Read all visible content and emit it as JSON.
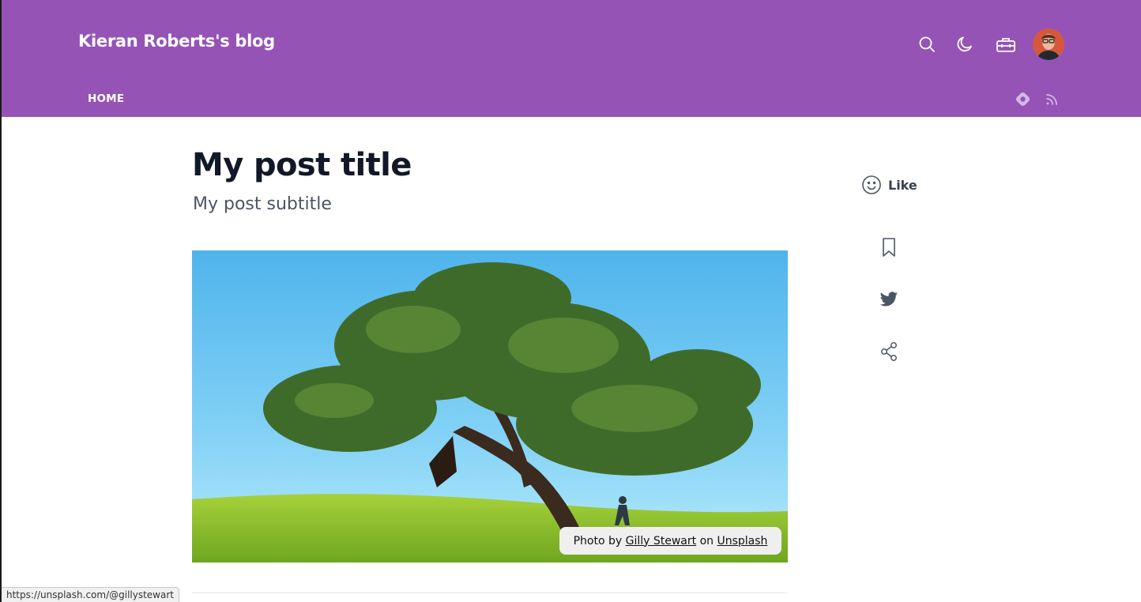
{
  "header": {
    "blog_title": "Kieran Roberts's blog",
    "nav": {
      "home": "HOME"
    },
    "icons": [
      "search-icon",
      "moon-icon",
      "toolbox-icon",
      "hashnode-icon",
      "rss-icon"
    ],
    "background_color": "#9553b6"
  },
  "post": {
    "title": "My post title",
    "subtitle": "My post subtitle",
    "cover_credit": {
      "prefix": "Photo by",
      "author": "Gilly Stewart",
      "middle": "on",
      "site": "Unsplash"
    }
  },
  "sidebar": {
    "like_label": "Like",
    "icons": [
      "smile-icon",
      "bookmark-icon",
      "twitter-icon",
      "share-icon"
    ]
  },
  "status_bar": {
    "url": "https://unsplash.com/@gillystewart"
  }
}
